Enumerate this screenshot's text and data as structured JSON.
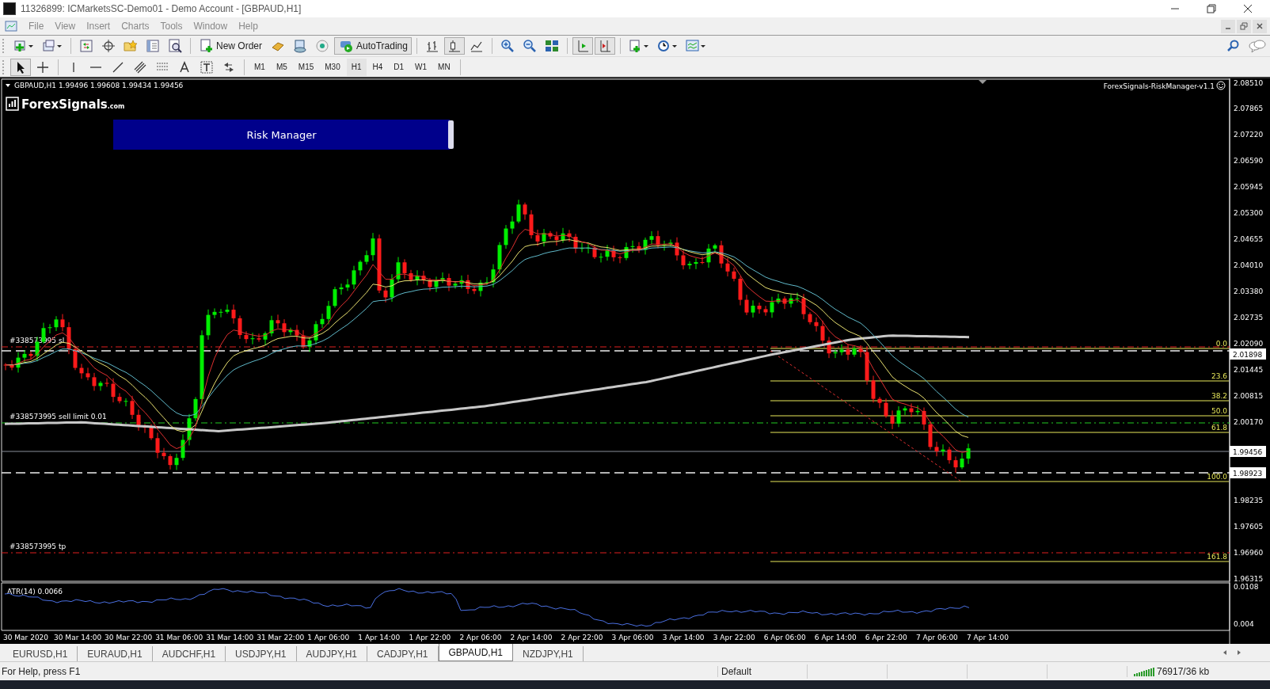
{
  "window": {
    "title": "11326899: ICMarketsSC-Demo01 - Demo Account - [GBPAUD,H1]"
  },
  "menu": [
    "File",
    "View",
    "Insert",
    "Charts",
    "Tools",
    "Window",
    "Help"
  ],
  "toolbar": {
    "new_order": "New Order",
    "autotrading": {
      "label": "AutoTrading",
      "on": true
    }
  },
  "chart_types": [
    {
      "kind": "bars",
      "selected": false
    },
    {
      "kind": "candles",
      "selected": true
    },
    {
      "kind": "line",
      "selected": false
    }
  ],
  "drawing_tools": [
    {
      "kind": "cursor",
      "selected": true
    },
    {
      "kind": "crosshair",
      "selected": false
    },
    {
      "kind": "vline",
      "selected": false
    },
    {
      "kind": "hline",
      "selected": false
    },
    {
      "kind": "trend",
      "selected": false
    },
    {
      "kind": "channel",
      "selected": false
    },
    {
      "kind": "fibo",
      "selected": false
    },
    {
      "kind": "text",
      "selected": false
    },
    {
      "kind": "label",
      "selected": false
    },
    {
      "kind": "arrows",
      "selected": false
    }
  ],
  "timeframes": [
    {
      "label": "M1",
      "selected": false
    },
    {
      "label": "M5",
      "selected": false
    },
    {
      "label": "M15",
      "selected": false
    },
    {
      "label": "M30",
      "selected": false
    },
    {
      "label": "H1",
      "selected": true
    },
    {
      "label": "H4",
      "selected": false
    },
    {
      "label": "D1",
      "selected": false
    },
    {
      "label": "W1",
      "selected": false
    },
    {
      "label": "MN",
      "selected": false
    }
  ],
  "chart": {
    "symbol_line": "GBPAUD,H1  1.99496 1.99608 1.99434 1.99456",
    "logo": {
      "name": "ForexSignals",
      "suffix": ".com"
    },
    "panel_button": "Risk Manager",
    "expert": "ForexSignals-RiskManager-v1.1",
    "price_ticks": [
      "2.08510",
      "2.07865",
      "2.07220",
      "2.06590",
      "2.05945",
      "2.05300",
      "2.04655",
      "2.04010",
      "2.03380",
      "2.02735",
      "2.02090",
      "2.01445",
      "2.00815",
      "2.00170",
      "1.98235",
      "1.97605",
      "1.96960",
      "1.96315"
    ],
    "price_markers": [
      "2.01898",
      "1.99456",
      "1.98923"
    ],
    "order_lines": [
      {
        "label": "#338573995 sl",
        "kind": "sl"
      },
      {
        "label": "#338573995 sell limit 0.01",
        "kind": "limit"
      },
      {
        "label": "#338573995 tp",
        "kind": "tp"
      }
    ],
    "fib_levels": [
      "0.0",
      "23.6",
      "38.2",
      "50.0",
      "61.8",
      "100.0",
      "161.8"
    ],
    "indicator": {
      "label": "ATR(14) 0.0066",
      "ticks": [
        "0.0108",
        "0.004"
      ]
    },
    "time_labels": [
      "30 Mar 2020",
      "30 Mar 14:00",
      "30 Mar 22:00",
      "31 Mar 06:00",
      "31 Mar 14:00",
      "31 Mar 22:00",
      "1 Apr 06:00",
      "1 Apr 14:00",
      "1 Apr 22:00",
      "2 Apr 06:00",
      "2 Apr 14:00",
      "2 Apr 22:00",
      "3 Apr 06:00",
      "3 Apr 14:00",
      "3 Apr 22:00",
      "6 Apr 06:00",
      "6 Apr 14:00",
      "6 Apr 22:00",
      "7 Apr 06:00",
      "7 Apr 14:00"
    ]
  },
  "tabs": [
    {
      "label": "EURUSD,H1",
      "selected": false
    },
    {
      "label": "EURAUD,H1",
      "selected": false
    },
    {
      "label": "AUDCHF,H1",
      "selected": false
    },
    {
      "label": "USDJPY,H1",
      "selected": false
    },
    {
      "label": "AUDJPY,H1",
      "selected": false
    },
    {
      "label": "CADJPY,H1",
      "selected": false
    },
    {
      "label": "GBPAUD,H1",
      "selected": true
    },
    {
      "label": "NZDJPY,H1",
      "selected": false
    }
  ],
  "status_bar": {
    "help": "For Help, press F1",
    "profile": "Default",
    "traffic": "76917/36 kb"
  }
}
